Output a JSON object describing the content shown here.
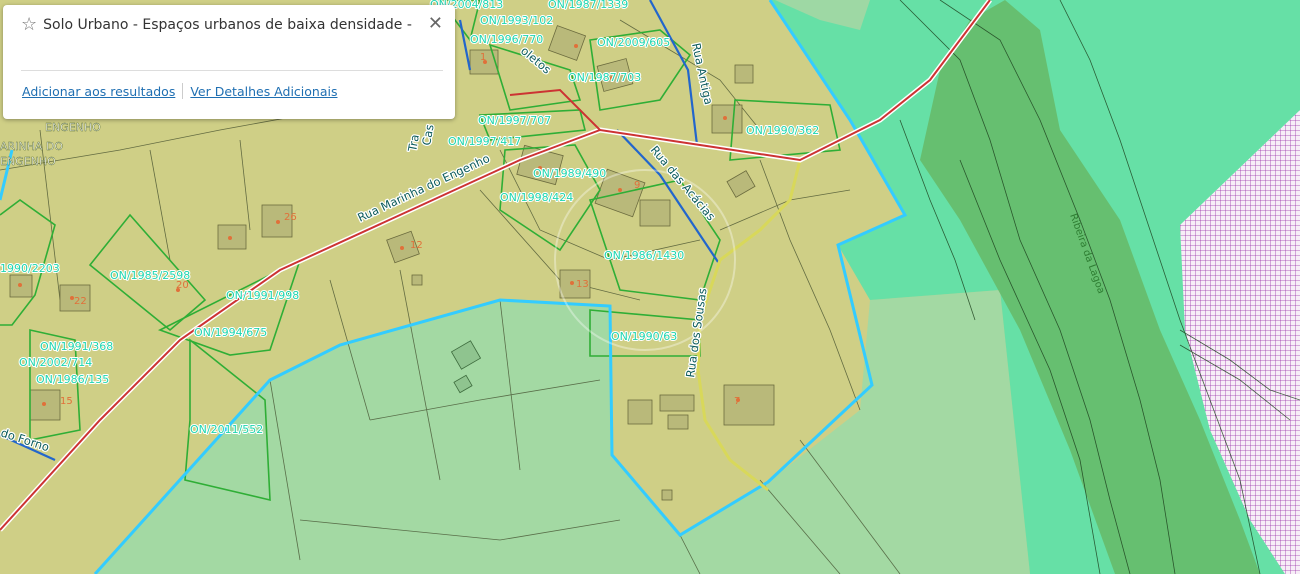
{
  "popup": {
    "title": "Solo Urbano - Espaços urbanos de baixa densidade -",
    "close_label": "✕",
    "action_add": "Adicionar aos resultados",
    "action_details": "Ver Detalhes Adicionais"
  },
  "map": {
    "colors": {
      "urban": "#cfcf86",
      "green_light": "#a3d9a3",
      "green_bright": "#66e0a6",
      "green_dark": "#66bb6a",
      "boundary": "#33ccff",
      "road": "#cc3333",
      "parcel": "#33aa33",
      "hatch": "#9933aa"
    },
    "streets": [
      "Rua Marinha do Engenho",
      "Rua das Acácias",
      "Rua Antiga",
      "Rua dos Sousas",
      "do Forno",
      "Cas",
      "Tra",
      "oletos",
      "Ribeira da Lagoa"
    ],
    "places": [
      "ENGENHO",
      "ARINHA DO",
      "ENGENHO"
    ],
    "parcels": [
      "ON/2004/813",
      "ON/1987/1339",
      "ON/1993/102",
      "ON/1996/770",
      "ON/2009/605",
      "ON/1987/703",
      "ON/1997/707",
      "ON/1997/417",
      "ON/1990/362",
      "ON/1989/490",
      "ON/1998/424",
      "ON/1986/1430",
      "ON/1985/2598",
      "ON/1991/998",
      "ON/1994/675",
      "ON/1990/63",
      "ON/1991/368",
      "ON/2002/714",
      "ON/1986/135",
      "ON/2011/552",
      "1990/2203"
    ],
    "house_numbers": [
      "1",
      "9",
      "12",
      "26",
      "20",
      "22",
      "13",
      "15",
      "7"
    ]
  }
}
